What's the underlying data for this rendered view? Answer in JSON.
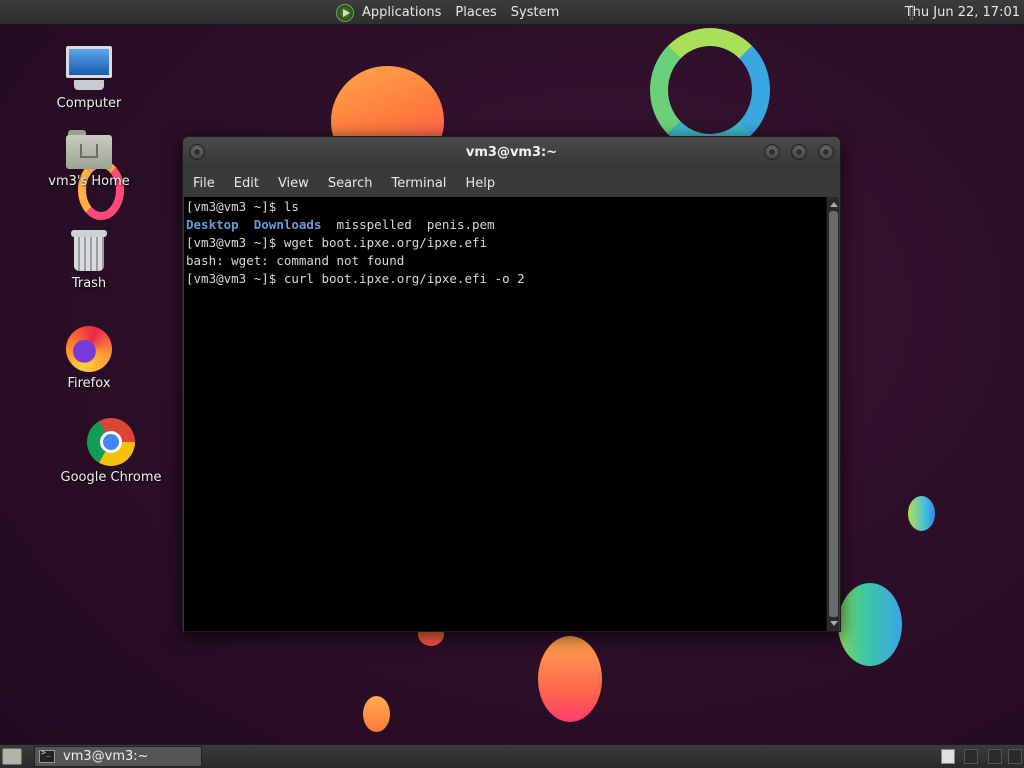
{
  "top_panel": {
    "menus": [
      "Applications",
      "Places",
      "System"
    ],
    "clock": "Thu Jun 22, 17:01"
  },
  "desktop_icons": {
    "computer": "Computer",
    "home": "vm3's Home",
    "trash": "Trash",
    "firefox": "Firefox",
    "chrome": "Google Chrome"
  },
  "terminal": {
    "title": "vm3@vm3:~",
    "menu": [
      "File",
      "Edit",
      "View",
      "Search",
      "Terminal",
      "Help"
    ],
    "lines": {
      "l1": "[vm3@vm3 ~]$ ls",
      "l2_dirs": [
        "Desktop",
        "Downloads"
      ],
      "l2_files": "misspelled  penis.pem",
      "l3": "[vm3@vm3 ~]$ wget boot.ipxe.org/ipxe.efi",
      "l4": "bash: wget: command not found",
      "l5": "[vm3@vm3 ~]$ curl boot.ipxe.org/ipxe.efi -o 2"
    }
  },
  "taskbar": {
    "task_label": "vm3@vm3:~"
  }
}
